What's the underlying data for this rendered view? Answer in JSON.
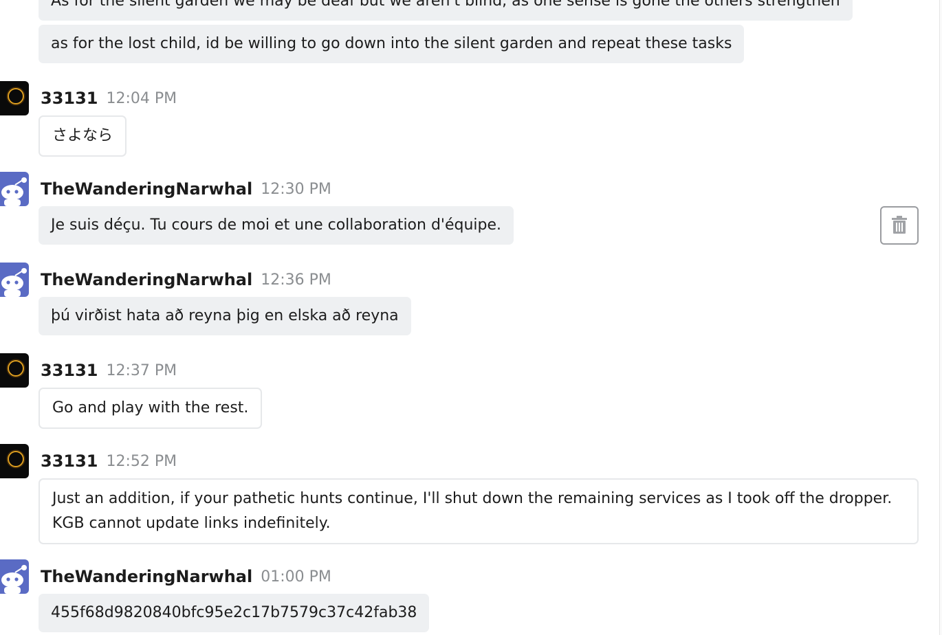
{
  "messages": [
    {
      "continuation": true,
      "text": "As for the silent garden we may be deaf but we aren't blind, as one sense is gone the others strengthen"
    },
    {
      "continuation": true,
      "text": "as for the lost child, id be willing to go down into the silent garden and repeat these tasks"
    },
    {
      "author": "33131",
      "avatar_icon": "eclipse-ring-icon",
      "time": "12:04 PM",
      "text": "さよなら"
    },
    {
      "author": "TheWanderingNarwhal",
      "avatar_icon": "reddit-snoo-icon",
      "time": "12:30 PM",
      "text": "Je suis déçu. Tu cours de moi et une collaboration d'équipe."
    },
    {
      "author": "TheWanderingNarwhal",
      "avatar_icon": "reddit-snoo-icon",
      "time": "12:36 PM",
      "text": "þú virðist hata að reyna þig en elska að reyna"
    },
    {
      "author": "33131",
      "avatar_icon": "eclipse-ring-icon",
      "time": "12:37 PM",
      "text": "Go and play with the rest."
    },
    {
      "author": "33131",
      "avatar_icon": "eclipse-ring-icon",
      "time": "12:52 PM",
      "text": "Just an addition, if your pathetic hunts continue, I'll shut down the remaining services as I took off the dropper. KGB cannot update links indefinitely."
    },
    {
      "author": "TheWanderingNarwhal",
      "avatar_icon": "reddit-snoo-icon",
      "time": "01:00 PM",
      "text": "455f68d9820840bfc95e2c17b7579c37c42fab38"
    }
  ],
  "actions": {
    "delete_icon": "trash-icon"
  },
  "colors": {
    "bubble_fill": "#eef0f2",
    "bubble_border": "#e6e8ea",
    "timestamp": "#8a8d90",
    "snoo_bg": "#5a6bc4",
    "eclipse_ring": "#e0a020"
  }
}
